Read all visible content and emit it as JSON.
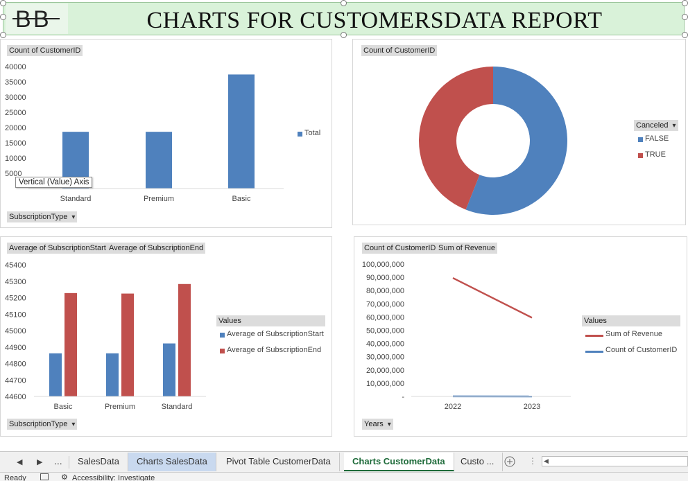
{
  "banner": {
    "title": "CHARTS FOR CUSTOMERSDATA REPORT",
    "logo_icon": "bb-monogram-logo"
  },
  "chart1": {
    "field_value": "Count of CustomerID",
    "field_axis": "SubscriptionType",
    "legend_label": "Total",
    "tooltip": "Vertical (Value) Axis",
    "yticks": [
      "40000",
      "35000",
      "30000",
      "25000",
      "20000",
      "15000",
      "10000",
      "5000"
    ]
  },
  "chart2": {
    "field_value": "Count of CustomerID",
    "legend_title": "Canceled",
    "legend_items": [
      "FALSE",
      "TRUE"
    ]
  },
  "chart3": {
    "field_value_1": "Average of SubscriptionStart",
    "field_value_2": "Average of SubscriptionEnd",
    "field_axis": "SubscriptionType",
    "legend_title": "Values",
    "legend_items": [
      "Average of SubscriptionStart",
      "Average of SubscriptionEnd"
    ],
    "yticks": [
      "45400",
      "45300",
      "45200",
      "45100",
      "45000",
      "44900",
      "44800",
      "44700",
      "44600"
    ]
  },
  "chart4": {
    "field_value_1": "Count of CustomerID",
    "field_value_2": "Sum of Revenue",
    "field_axis": "Years",
    "legend_title": "Values",
    "legend_items": [
      "Sum of Revenue",
      "Count of CustomerID"
    ],
    "yticks": [
      "100,000,000",
      "90,000,000",
      "80,000,000",
      "70,000,000",
      "60,000,000",
      "50,000,000",
      "40,000,000",
      "30,000,000",
      "20,000,000",
      "10,000,000",
      "-"
    ]
  },
  "chart_data": [
    {
      "type": "bar",
      "categories": [
        "Standard",
        "Premium",
        "Basic"
      ],
      "series": [
        {
          "name": "Total",
          "values": [
            18600,
            18600,
            37400
          ]
        }
      ],
      "xlabel": "",
      "ylabel": "",
      "ylim": [
        0,
        40000
      ],
      "color": "#4f81bd",
      "legend": "right",
      "grid": false
    },
    {
      "type": "pie",
      "categories": [
        "FALSE",
        "TRUE"
      ],
      "values": [
        56,
        44
      ],
      "colors": [
        "#4f81bd",
        "#c0504d"
      ],
      "donut": true,
      "legend": "right"
    },
    {
      "type": "bar",
      "categories": [
        "Basic",
        "Premium",
        "Standard"
      ],
      "series": [
        {
          "name": "Average of SubscriptionStart",
          "values": [
            44862,
            44862,
            44922
          ]
        },
        {
          "name": "Average of SubscriptionEnd",
          "values": [
            45228,
            45225,
            45283
          ]
        }
      ],
      "ylim": [
        44600,
        45400
      ],
      "colors": [
        "#4f81bd",
        "#c0504d"
      ],
      "legend": "right",
      "grid": false
    },
    {
      "type": "line",
      "x": [
        "2022",
        "2023"
      ],
      "series": [
        {
          "name": "Sum of Revenue",
          "values": [
            89500000,
            59500000
          ]
        },
        {
          "name": "Count of CustomerID",
          "values": [
            40000,
            25000
          ]
        }
      ],
      "ylim": [
        0,
        100000000
      ],
      "colors": [
        "#c0504d",
        "#4f81bd"
      ],
      "legend": "right",
      "grid": false
    }
  ],
  "tabs": {
    "nav_prev": "◀",
    "nav_next": "▶",
    "ellipsis": "...",
    "items": [
      "SalesData",
      "Charts SalesData",
      "Pivot Table CustomerData",
      "Charts CustomerData",
      "Custo ..."
    ],
    "active_index": 3,
    "highlight_index": 1,
    "add_icon": "plus-circle-icon"
  },
  "status": {
    "ready": "Ready",
    "accessibility": "Accessibility: Investigate"
  }
}
